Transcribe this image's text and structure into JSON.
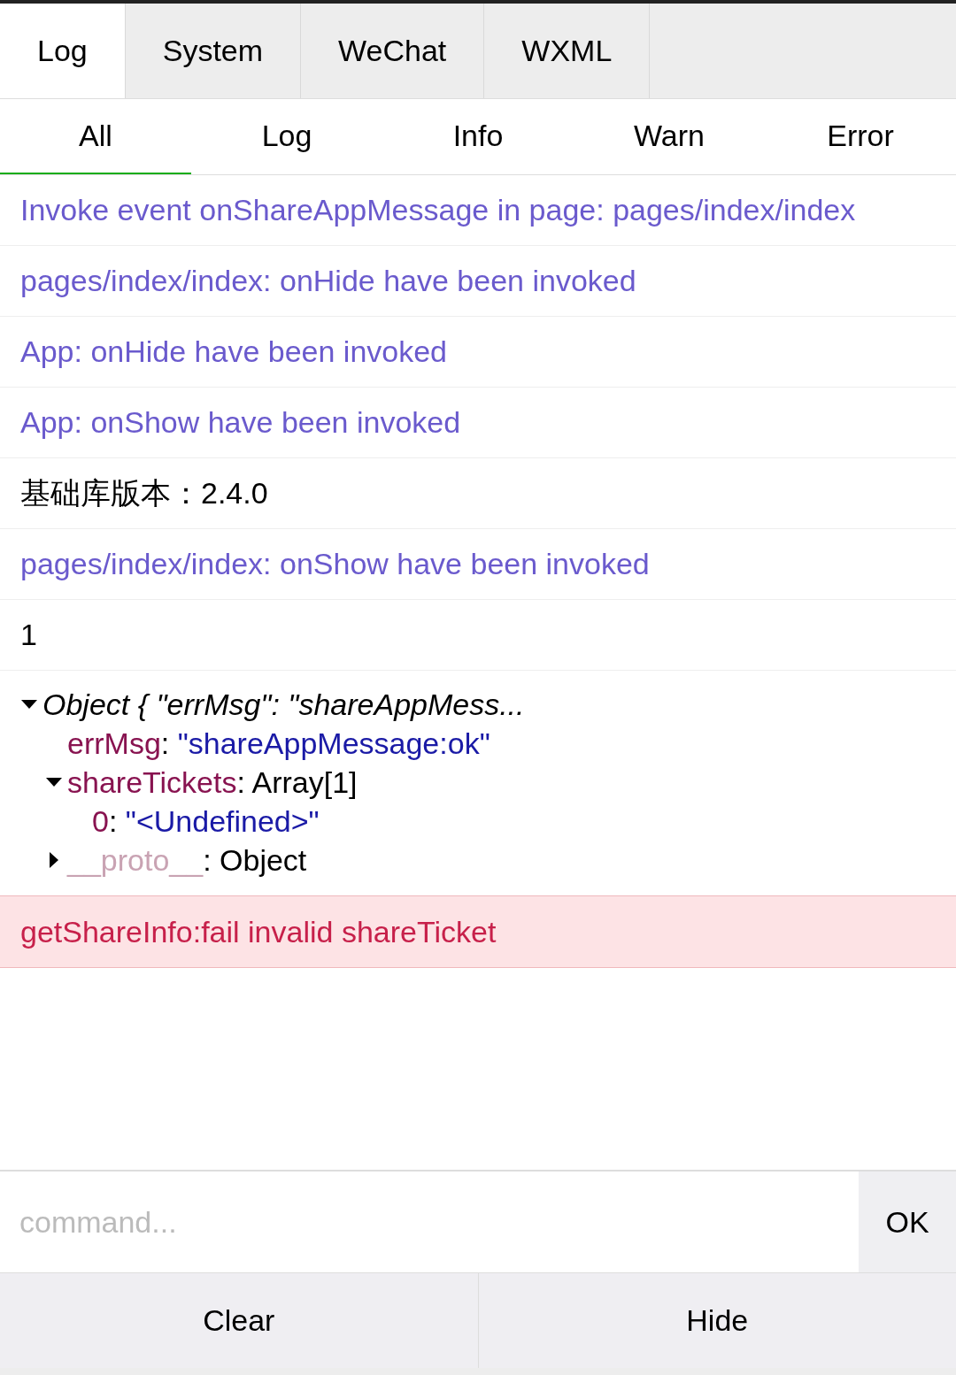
{
  "tabs": [
    {
      "label": "Log",
      "selected": true
    },
    {
      "label": "System",
      "selected": false
    },
    {
      "label": "WeChat",
      "selected": false
    },
    {
      "label": "WXML",
      "selected": false
    }
  ],
  "filters": [
    {
      "label": "All",
      "selected": true
    },
    {
      "label": "Log",
      "selected": false
    },
    {
      "label": "Info",
      "selected": false
    },
    {
      "label": "Warn",
      "selected": false
    },
    {
      "label": "Error",
      "selected": false
    }
  ],
  "entries": [
    {
      "kind": "info",
      "text": "Invoke event onShareAppMessage in page: pages/index/index"
    },
    {
      "kind": "info",
      "text": "pages/index/index: onHide have been invoked"
    },
    {
      "kind": "info",
      "text": "App: onHide have been invoked"
    },
    {
      "kind": "info",
      "text": "App: onShow have been invoked"
    },
    {
      "kind": "log",
      "text": "基础库版本：2.4.0"
    },
    {
      "kind": "info",
      "text": "pages/index/index: onShow have been invoked"
    },
    {
      "kind": "log",
      "text": "1"
    },
    {
      "kind": "object",
      "summary": "Object { \"errMsg\": \"shareAppMess...",
      "expanded": true,
      "children": [
        {
          "kind": "string",
          "key": "errMsg",
          "separator": ":",
          "value": "\"shareAppMessage:ok\""
        },
        {
          "kind": "object",
          "key": "shareTickets",
          "separator": ":",
          "value": "Array[1]",
          "expanded": true,
          "children": [
            {
              "kind": "string",
              "key": "0",
              "separator": ":",
              "value": "\"<Undefined>\""
            }
          ]
        },
        {
          "kind": "proto",
          "key": "__proto__",
          "separator": ":",
          "value": "Object",
          "expanded": false
        }
      ]
    },
    {
      "kind": "error",
      "text": "getShareInfo:fail invalid shareTicket"
    }
  ],
  "command": {
    "placeholder": "command...",
    "button": "OK"
  },
  "buttons": [
    "Clear",
    "Hide"
  ]
}
